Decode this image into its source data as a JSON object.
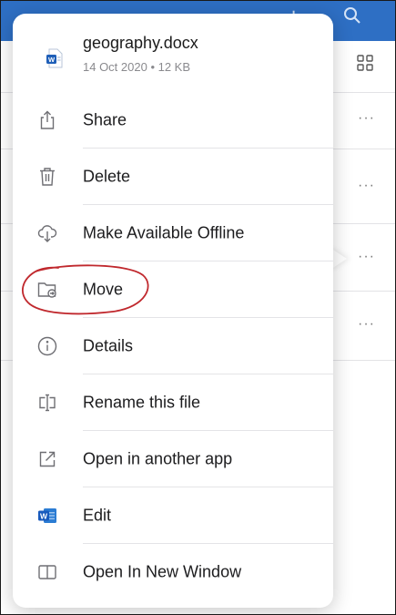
{
  "file": {
    "name": "geography.docx",
    "meta": "14 Oct 2020 • 12 KB",
    "icon": "word-document-icon"
  },
  "menu": {
    "items": [
      {
        "label": "Share",
        "icon": "share-icon"
      },
      {
        "label": "Delete",
        "icon": "trash-icon"
      },
      {
        "label": "Make Available Offline",
        "icon": "cloud-download-icon"
      },
      {
        "label": "Move",
        "icon": "folder-move-icon"
      },
      {
        "label": "Details",
        "icon": "info-icon"
      },
      {
        "label": "Rename this file",
        "icon": "rename-icon"
      },
      {
        "label": "Open in another app",
        "icon": "open-external-icon"
      },
      {
        "label": "Edit",
        "icon": "word-app-icon"
      },
      {
        "label": "Open In New Window",
        "icon": "new-window-icon"
      }
    ]
  },
  "background": {
    "row_more_label": "···",
    "accent_color": "#2e6fc4",
    "annotation_color": "#c0282d"
  }
}
